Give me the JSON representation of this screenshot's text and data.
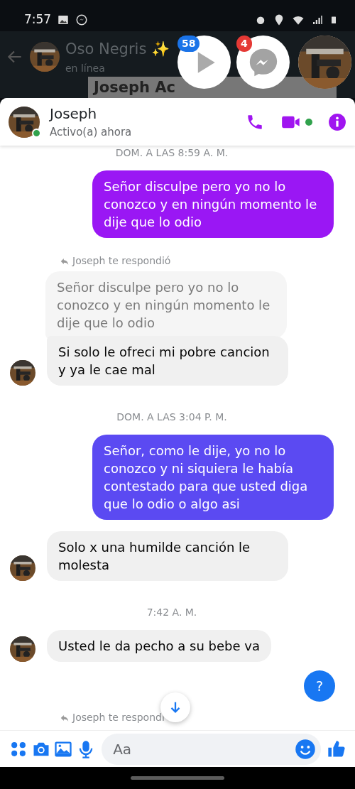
{
  "status_bar": {
    "time": "7:57"
  },
  "background_chat": {
    "name": "Oso Negris ✨",
    "status": "en línea",
    "banner": "Joseph Ac"
  },
  "chat_heads": [
    {
      "kind": "video",
      "badge": "58"
    },
    {
      "kind": "messenger",
      "badge": "4"
    },
    {
      "kind": "avatar"
    }
  ],
  "header": {
    "name": "Joseph",
    "status": "Activo(a) ahora",
    "online": true,
    "video_active": true
  },
  "messages": [
    {
      "kind": "timestamp",
      "text": "DOM. A LAS 8:59 A. M."
    },
    {
      "kind": "outgoing",
      "text": "Señor disculpe pero yo no lo conozco y en ningún momento le dije que lo odio",
      "color": "#9a17f4"
    },
    {
      "kind": "reply_label",
      "text": "Joseph te respondió"
    },
    {
      "kind": "incoming",
      "quoted": "Señor disculpe pero yo no lo conozco y en ningún momento le dije que lo odio",
      "text": "Si solo le ofreci mi pobre cancion y ya le cae mal",
      "avatar": true
    },
    {
      "kind": "timestamp",
      "text": "DOM. A LAS 3:04 P. M."
    },
    {
      "kind": "outgoing",
      "text": "Señor, como le dije, yo no lo conozco y ni siquiera le había contestado para que usted diga que lo odio o algo asi",
      "color": "#5b4af2"
    },
    {
      "kind": "incoming",
      "text": "Solo x una humilde canción le molesta",
      "avatar": true
    },
    {
      "kind": "timestamp",
      "text": "7:42 A. M."
    },
    {
      "kind": "incoming",
      "text": "Usted le da pecho a su bebe va",
      "avatar": true
    },
    {
      "kind": "help",
      "text": "?"
    },
    {
      "kind": "reply_label",
      "text": "Joseph te respondi",
      "cut": true
    }
  ],
  "composer": {
    "placeholder": "Aa"
  }
}
